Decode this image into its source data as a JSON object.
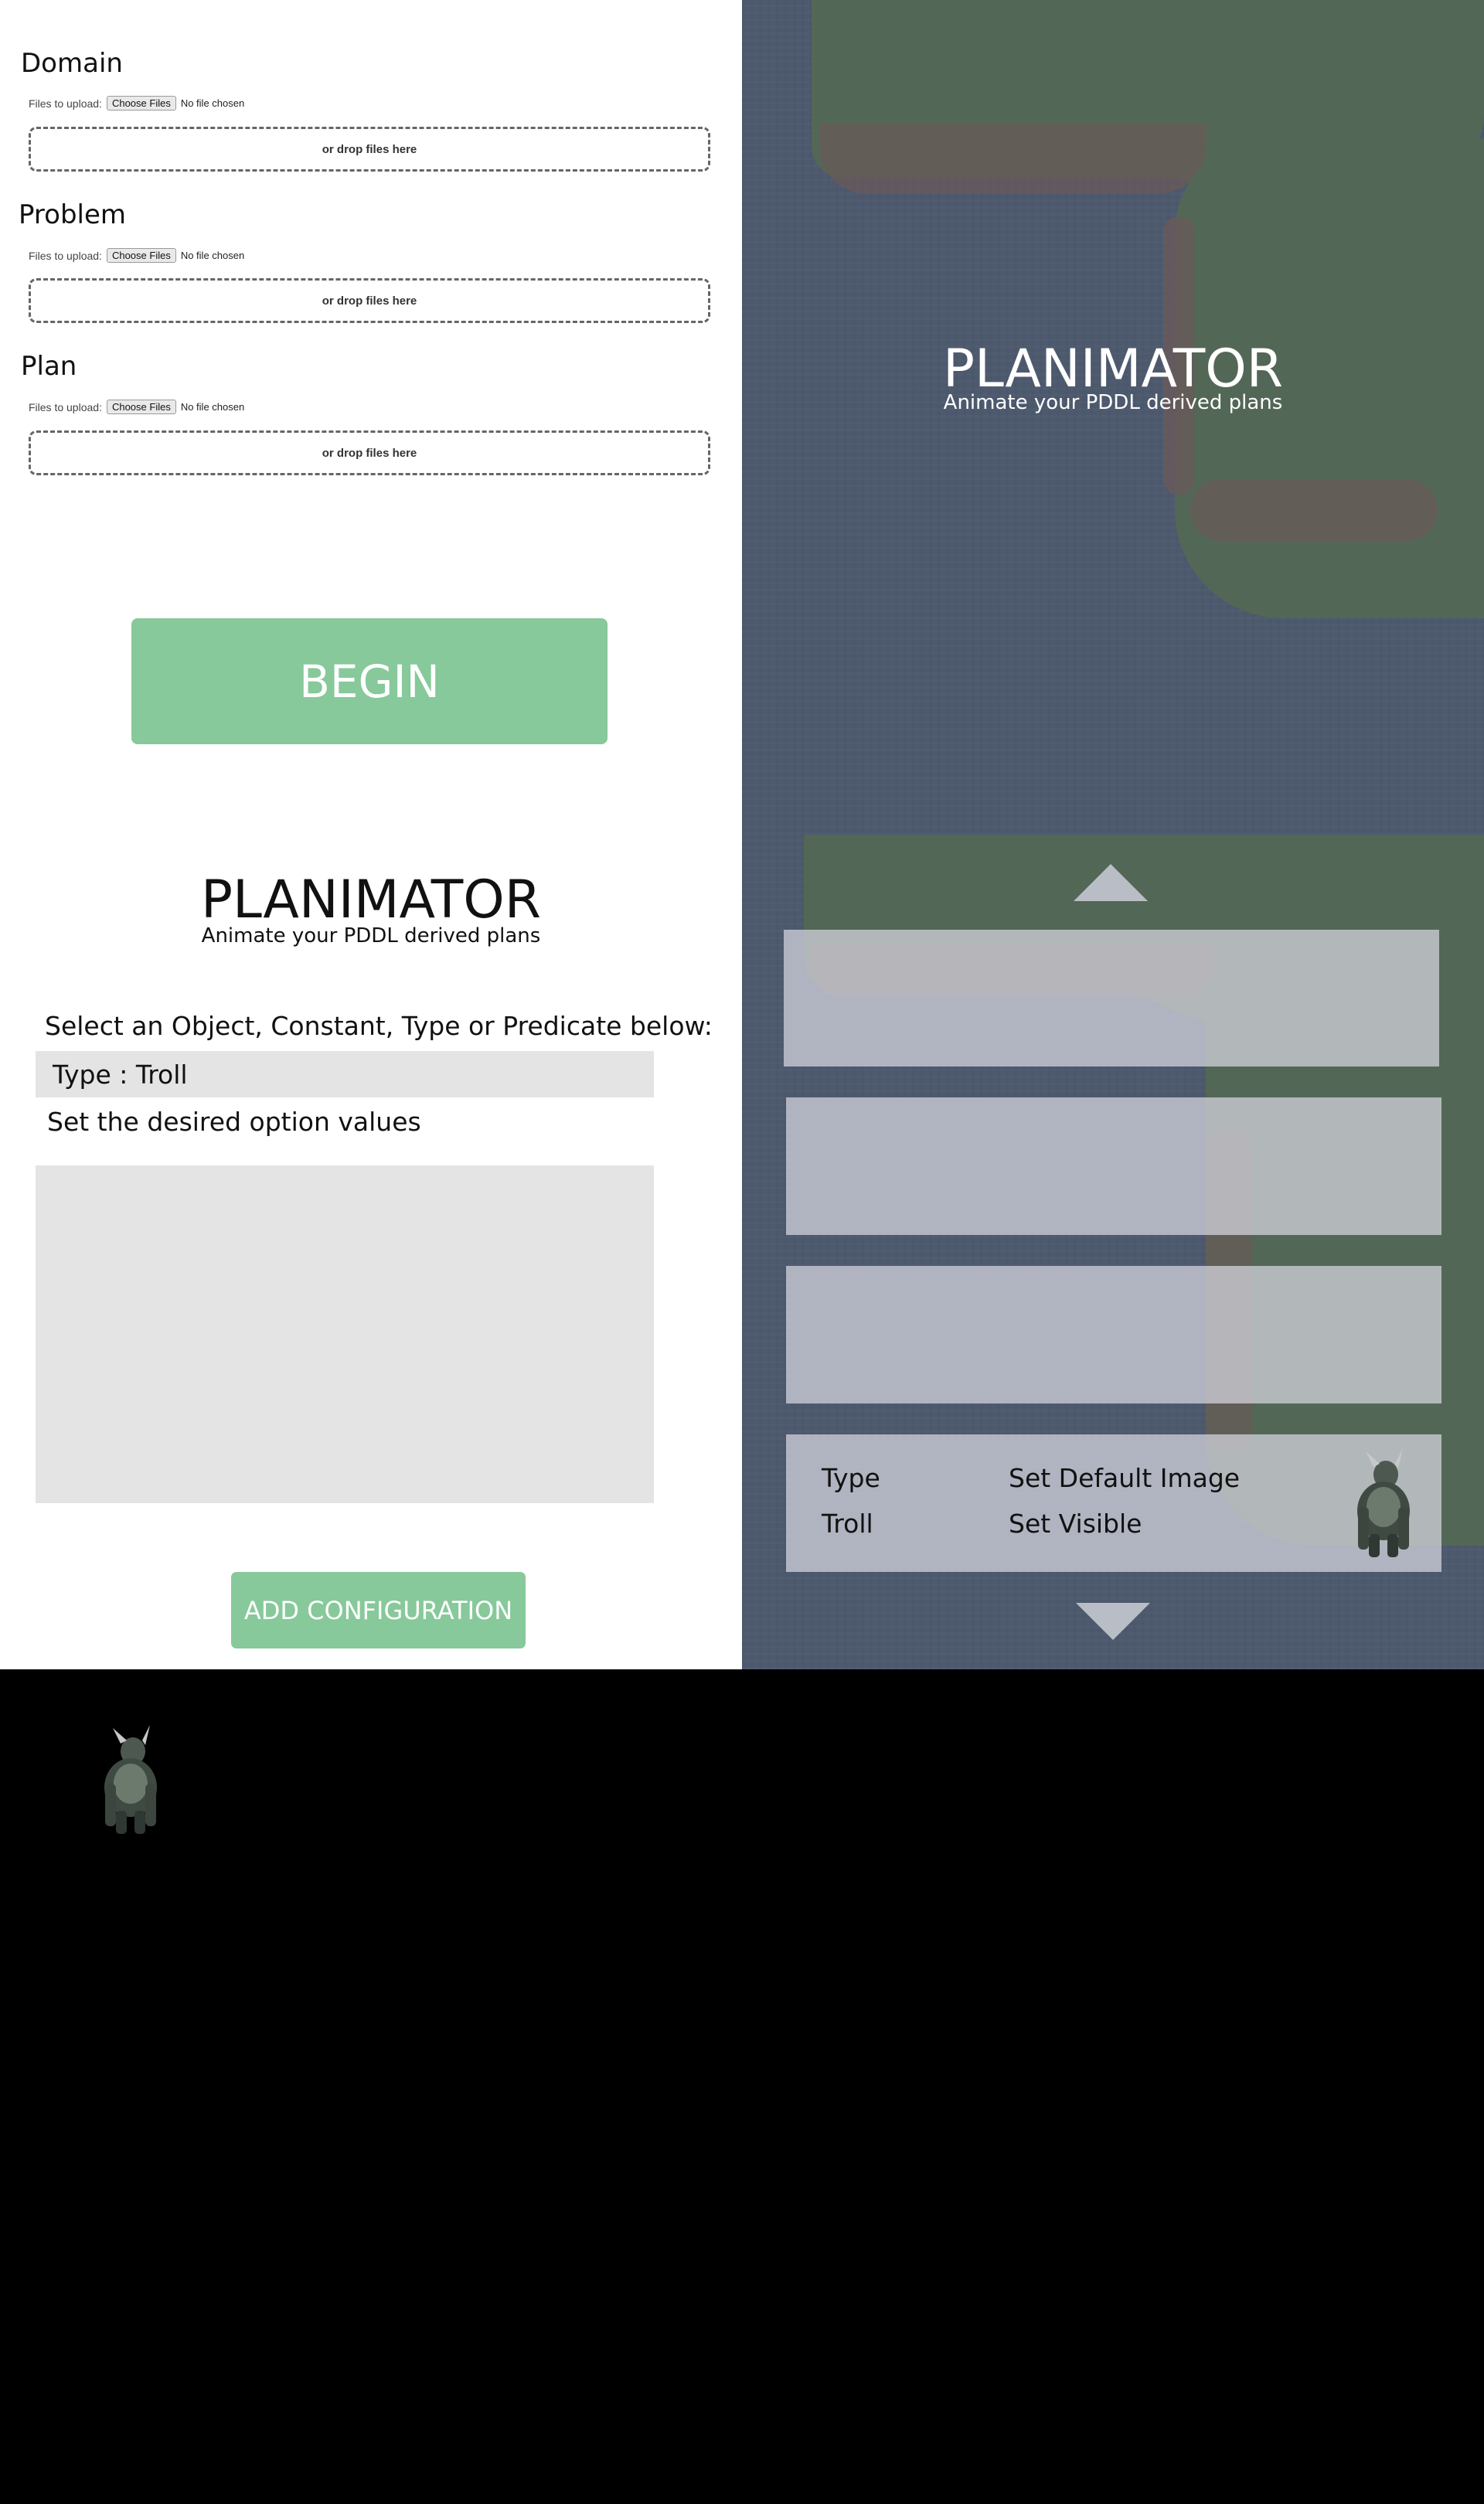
{
  "upload": {
    "sections": [
      {
        "heading": "Domain",
        "files_label": "Files to upload:",
        "choose_label": "Choose Files",
        "no_file": "No file chosen",
        "drop_text": "or drop files here"
      },
      {
        "heading": "Problem",
        "files_label": "Files to upload:",
        "choose_label": "Choose Files",
        "no_file": "No file chosen",
        "drop_text": "or drop files here"
      },
      {
        "heading": "Plan",
        "files_label": "Files to upload:",
        "choose_label": "Choose Files",
        "no_file": "No file chosen",
        "drop_text": "or drop files here"
      }
    ],
    "begin_label": "BEGIN"
  },
  "hero": {
    "title": "PLANIMATOR",
    "subtitle": "Animate your PDDL derived plans"
  },
  "config": {
    "title": "PLANIMATOR",
    "subtitle": "Animate your PDDL derived plans",
    "select_prompt": "Select an Object, Constant, Type or Predicate below:",
    "selected_item": "Type : Troll",
    "options_prompt": "Set the desired option values",
    "add_label": "ADD CONFIGURATION"
  },
  "config_list": {
    "active_card": {
      "kind": "Type",
      "name": "Troll",
      "action_1": "Set Default Image",
      "action_2": "Set Visible",
      "image_icon": "troll-icon"
    }
  },
  "colors": {
    "accent_green": "#87c99a",
    "panel_gray": "#e4e4e4",
    "map_overlay": "#4d5a6e"
  }
}
